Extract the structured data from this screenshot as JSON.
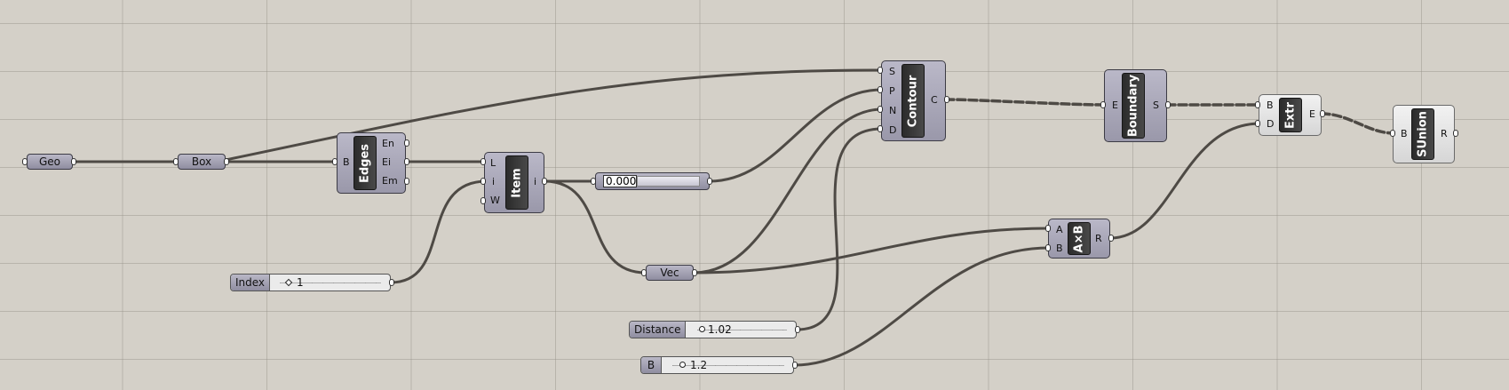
{
  "canvas": {
    "background": "#d4d0c8"
  },
  "params": {
    "geo": "Geo",
    "box": "Box",
    "vec": "Vec"
  },
  "components": {
    "edges": {
      "name": "Edges",
      "inputs": [
        "B"
      ],
      "outputs": [
        "En",
        "Ei",
        "Em"
      ]
    },
    "item": {
      "name": "Item",
      "inputs": [
        "L",
        "i",
        "W"
      ],
      "outputs": [
        "i"
      ]
    },
    "contour": {
      "name": "Contour",
      "inputs": [
        "S",
        "P",
        "N",
        "D"
      ],
      "outputs": [
        "C"
      ]
    },
    "boundary": {
      "name": "Boundary",
      "inputs": [
        "E"
      ],
      "outputs": [
        "S"
      ]
    },
    "extr": {
      "name": "Extr",
      "inputs": [
        "B",
        "D"
      ],
      "outputs": [
        "E"
      ]
    },
    "axb": {
      "name": "A×B",
      "inputs": [
        "A",
        "B"
      ],
      "outputs": [
        "R"
      ]
    },
    "sunion": {
      "name": "SUnion",
      "inputs": [
        "B"
      ],
      "outputs": [
        "R"
      ]
    }
  },
  "sliders": {
    "index": {
      "label": "Index",
      "value": "1"
    },
    "distance": {
      "label": "Distance",
      "value": "1.02"
    },
    "b": {
      "label": "B",
      "value": "1.2"
    }
  },
  "panel": {
    "value": "0.000"
  },
  "colors": {
    "wire": "#4e4a45",
    "component": "#a5a3b5",
    "core": "#333333"
  }
}
